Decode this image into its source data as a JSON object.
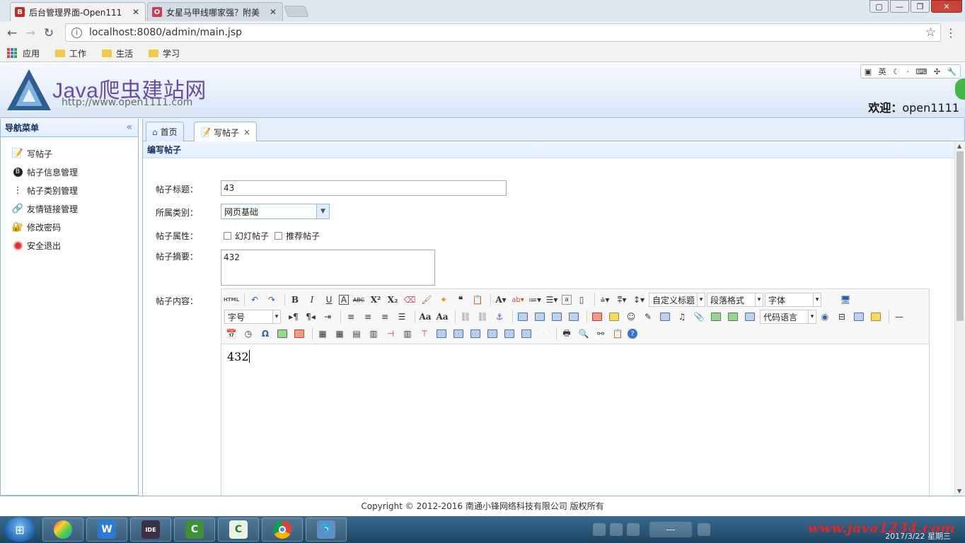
{
  "browser": {
    "tabs": [
      {
        "favicon": "B",
        "favicon_color": "#c62b2b",
        "title": "后台管理界面-Open111",
        "active": true
      },
      {
        "favicon": "O",
        "favicon_color": "#c73a5b",
        "title": "女星马甲线哪家强？附美",
        "active": false
      }
    ],
    "url": "localhost:8080/admin/main.jsp",
    "bookmarks": [
      "应用",
      "工作",
      "生活",
      "学习"
    ]
  },
  "header": {
    "logo_text": "Java爬虫建站网",
    "logo_url": "http://www.open1111.com",
    "welcome_label": "欢迎：",
    "username": "open1111",
    "ime_lang": "英"
  },
  "sidebar": {
    "title": "导航菜单",
    "items": [
      {
        "label": "写帖子",
        "icon": "edit-icon"
      },
      {
        "label": "帖子信息管理",
        "icon": "info-icon"
      },
      {
        "label": "帖子类别管理",
        "icon": "tree-icon"
      },
      {
        "label": "友情链接管理",
        "icon": "link-icon"
      },
      {
        "label": "修改密码",
        "icon": "key-icon"
      },
      {
        "label": "安全退出",
        "icon": "exit-icon"
      }
    ]
  },
  "content_tabs": [
    {
      "label": "首页",
      "icon": "home-icon",
      "closable": false
    },
    {
      "label": "写帖子",
      "icon": "edit-icon",
      "closable": true
    }
  ],
  "form": {
    "panel_title": "编写帖子",
    "title_label": "帖子标题：",
    "title_value": "43",
    "category_label": "所属类别：",
    "category_value": "网页基础",
    "attr_label": "帖子属性：",
    "attr_options": [
      "幻灯帖子",
      "推荐帖子"
    ],
    "summary_label": "帖子摘要：",
    "summary_value": "432",
    "content_label": "帖子内容："
  },
  "editor": {
    "dropdowns": {
      "custom_title": "自定义标题",
      "paragraph": "段落格式",
      "font": "字体",
      "font_size": "字号",
      "code_lang": "代码语言"
    },
    "body_text": "432"
  },
  "footer": {
    "copyright": "Copyright © 2012-2016 南通小锋网络科技有限公司 版权所有"
  },
  "taskbar": {
    "watermark": "www.java1234.com",
    "date": "2017/3/22 星期三",
    "tray_text": "---"
  },
  "colors": {
    "accent": "#95b8e7",
    "header_bg": "#d9e6f7",
    "logo": "#6a4aa3"
  }
}
